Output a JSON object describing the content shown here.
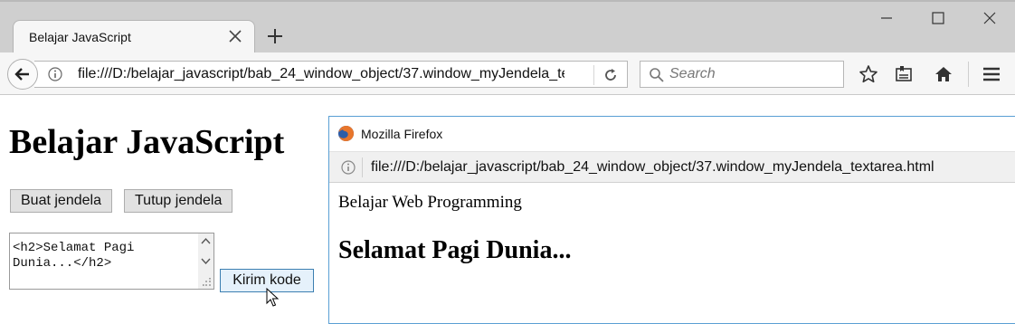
{
  "browser": {
    "tab": {
      "title": "Belajar JavaScript"
    },
    "url": "file:///D:/belajar_javascript/bab_24_window_object/37.window_myJendela_textarea.html",
    "search_placeholder": "Search"
  },
  "page": {
    "heading": "Belajar JavaScript",
    "buttons": {
      "buat": "Buat jendela",
      "tutup": "Tutup jendela",
      "kirim": "Kirim kode"
    },
    "textarea_value": "<h2>Selamat Pagi\nDunia...</h2>"
  },
  "popup": {
    "title": "Mozilla Firefox",
    "url": "file:///D:/belajar_javascript/bab_24_window_object/37.window_myJendela_textarea.html",
    "paragraph": "Belajar Web Programming",
    "heading": "Selamat Pagi Dunia..."
  }
}
